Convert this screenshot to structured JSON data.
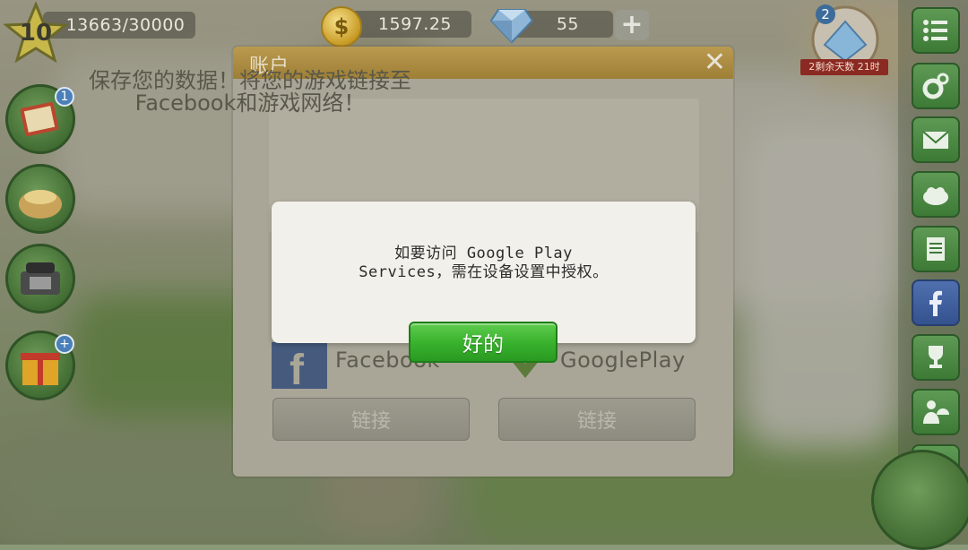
{
  "hud": {
    "level": "10",
    "xp": "13663/30000",
    "coins": "1597.25",
    "gems": "55",
    "add_gems_label": "+",
    "coin_symbol": "$"
  },
  "event": {
    "count": "2",
    "ribbon": "2剩余天数 21时"
  },
  "left_buttons": [
    {
      "name": "recipe-book",
      "badge": "1"
    },
    {
      "name": "ingredients"
    },
    {
      "name": "telephone"
    },
    {
      "name": "gift",
      "badge": "+"
    }
  ],
  "right_buttons": [
    {
      "name": "menu-list-icon"
    },
    {
      "name": "settings-gears-icon"
    },
    {
      "name": "mail-icon"
    },
    {
      "name": "food-icon"
    },
    {
      "name": "notes-icon"
    },
    {
      "name": "facebook-icon"
    },
    {
      "name": "trophy-icon"
    },
    {
      "name": "waiter-icon"
    },
    {
      "name": "chat-icon"
    }
  ],
  "account_dialog": {
    "title": "账户",
    "close": "✕",
    "message": "保存您的数据！将您的游戏链接至 Facebook和游戏网络！",
    "facebook_label": "Facebook",
    "google_label": "GooglePlay",
    "link_facebook": "链接",
    "link_google": "链接"
  },
  "alert": {
    "message": "如要访问 Google Play\nServices，需在设备设置中授权。",
    "ok_label": "好的"
  },
  "colors": {
    "ok_green": "#37b02c",
    "account_header": "#b99a4f",
    "badge_blue": "#4a7fb8"
  }
}
